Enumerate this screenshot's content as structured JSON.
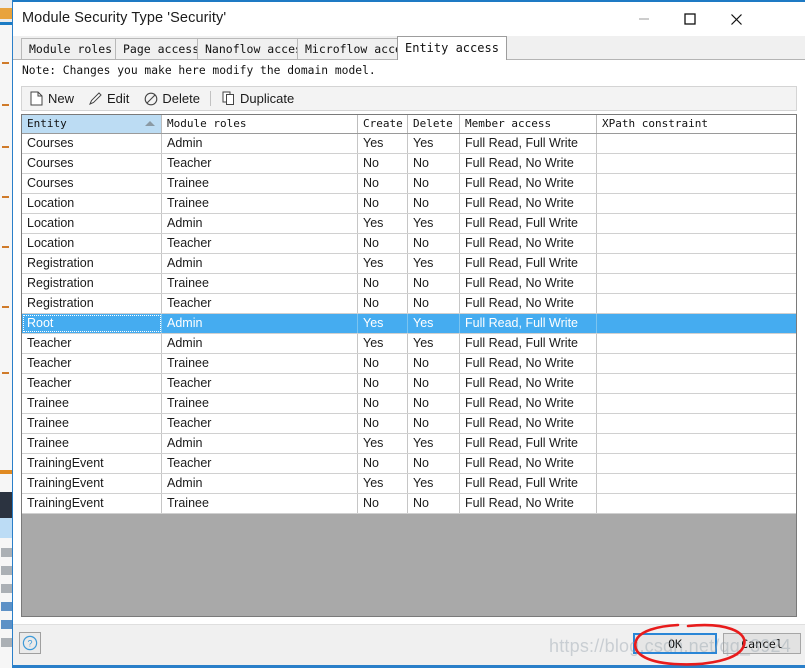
{
  "window": {
    "title": "Module Security Type 'Security'",
    "controls": {
      "minimize": "minimize-button",
      "maximize": "maximize-button",
      "close": "close-button"
    }
  },
  "tabs": [
    {
      "label": "Module roles",
      "active": false
    },
    {
      "label": "Page access",
      "active": false
    },
    {
      "label": "Nanoflow access",
      "active": false
    },
    {
      "label": "Microflow access",
      "active": false
    },
    {
      "label": "Entity access",
      "active": true
    }
  ],
  "note": "Note: Changes you make here modify the domain model.",
  "toolbar": {
    "new_label": "New",
    "edit_label": "Edit",
    "delete_label": "Delete",
    "duplicate_label": "Duplicate"
  },
  "grid": {
    "sort_column": "Entity",
    "sort_direction": "ascending",
    "columns": [
      "Entity",
      "Module roles",
      "Create",
      "Delete",
      "Member access",
      "XPath constraint"
    ],
    "rows": [
      {
        "entity": "Courses",
        "role": "Admin",
        "create": "Yes",
        "delete": "Yes",
        "member": "Full Read, Full Write",
        "xpath": "",
        "selected": false
      },
      {
        "entity": "Courses",
        "role": "Teacher",
        "create": "No",
        "delete": "No",
        "member": "Full Read, No Write",
        "xpath": "",
        "selected": false
      },
      {
        "entity": "Courses",
        "role": "Trainee",
        "create": "No",
        "delete": "No",
        "member": "Full Read, No Write",
        "xpath": "",
        "selected": false
      },
      {
        "entity": "Location",
        "role": "Trainee",
        "create": "No",
        "delete": "No",
        "member": "Full Read, No Write",
        "xpath": "",
        "selected": false
      },
      {
        "entity": "Location",
        "role": "Admin",
        "create": "Yes",
        "delete": "Yes",
        "member": "Full Read, Full Write",
        "xpath": "",
        "selected": false
      },
      {
        "entity": "Location",
        "role": "Teacher",
        "create": "No",
        "delete": "No",
        "member": "Full Read, No Write",
        "xpath": "",
        "selected": false
      },
      {
        "entity": "Registration",
        "role": "Admin",
        "create": "Yes",
        "delete": "Yes",
        "member": "Full Read, Full Write",
        "xpath": "",
        "selected": false
      },
      {
        "entity": "Registration",
        "role": "Trainee",
        "create": "No",
        "delete": "No",
        "member": "Full Read, No Write",
        "xpath": "",
        "selected": false
      },
      {
        "entity": "Registration",
        "role": "Teacher",
        "create": "No",
        "delete": "No",
        "member": "Full Read, No Write",
        "xpath": "",
        "selected": false
      },
      {
        "entity": "Root",
        "role": "Admin",
        "create": "Yes",
        "delete": "Yes",
        "member": "Full Read, Full Write",
        "xpath": "",
        "selected": true
      },
      {
        "entity": "Teacher",
        "role": "Admin",
        "create": "Yes",
        "delete": "Yes",
        "member": "Full Read, Full Write",
        "xpath": "",
        "selected": false
      },
      {
        "entity": "Teacher",
        "role": "Trainee",
        "create": "No",
        "delete": "No",
        "member": "Full Read, No Write",
        "xpath": "",
        "selected": false
      },
      {
        "entity": "Teacher",
        "role": "Teacher",
        "create": "No",
        "delete": "No",
        "member": "Full Read, No Write",
        "xpath": "",
        "selected": false
      },
      {
        "entity": "Trainee",
        "role": "Trainee",
        "create": "No",
        "delete": "No",
        "member": "Full Read, No Write",
        "xpath": "",
        "selected": false
      },
      {
        "entity": "Trainee",
        "role": "Teacher",
        "create": "No",
        "delete": "No",
        "member": "Full Read, No Write",
        "xpath": "",
        "selected": false
      },
      {
        "entity": "Trainee",
        "role": "Admin",
        "create": "Yes",
        "delete": "Yes",
        "member": "Full Read, Full Write",
        "xpath": "",
        "selected": false
      },
      {
        "entity": "TrainingEvent",
        "role": "Teacher",
        "create": "No",
        "delete": "No",
        "member": "Full Read, No Write",
        "xpath": "",
        "selected": false
      },
      {
        "entity": "TrainingEvent",
        "role": "Admin",
        "create": "Yes",
        "delete": "Yes",
        "member": "Full Read, Full Write",
        "xpath": "",
        "selected": false
      },
      {
        "entity": "TrainingEvent",
        "role": "Trainee",
        "create": "No",
        "delete": "No",
        "member": "Full Read, No Write",
        "xpath": "",
        "selected": false
      }
    ]
  },
  "footer": {
    "help_label": "?",
    "ok_label": "OK",
    "cancel_label": "Cancel"
  },
  "watermark": "https://blog.csdn.net/qq_3924",
  "colors": {
    "accent": "#2a7fc9",
    "selection": "#45acf0",
    "sorted_header": "#bcdcf3",
    "annotation": "#e81c1c",
    "empty_area": "#a9a9a9"
  }
}
